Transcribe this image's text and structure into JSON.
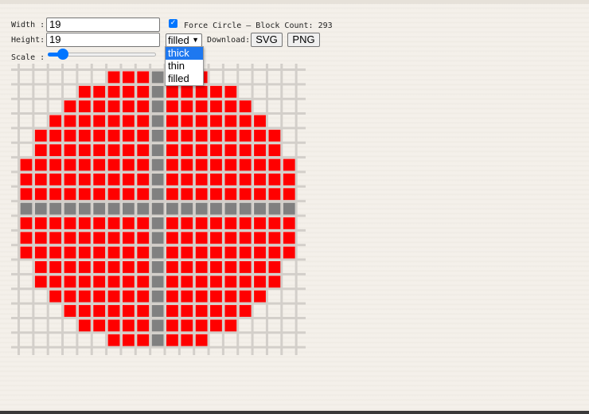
{
  "controls": {
    "width_label": "Width :",
    "width_value": "19",
    "height_label": "Height:",
    "height_value": "19",
    "force_circle_checked": true,
    "force_circle_label": "Force Circle — Block Count: 293",
    "mode_selected": "filled",
    "mode_options": [
      "thick",
      "thin",
      "filled"
    ],
    "mode_highlighted": "thick",
    "download_label": "Download:",
    "svg_button": "SVG",
    "png_button": "PNG",
    "scale_label": "Scale :",
    "scale_fraction": 0.1
  },
  "grid": {
    "columns": 19,
    "rows": 19,
    "fill_color": "#ff0000",
    "axis_color": "#808080",
    "line_color": "#d3cfca",
    "axis_row": 9,
    "axis_col": 9,
    "row_spans": [
      [
        6,
        12
      ],
      [
        4,
        14
      ],
      [
        3,
        15
      ],
      [
        2,
        16
      ],
      [
        1,
        17
      ],
      [
        1,
        17
      ],
      [
        0,
        18
      ],
      [
        0,
        18
      ],
      [
        0,
        18
      ],
      [
        0,
        18
      ],
      [
        0,
        18
      ],
      [
        0,
        18
      ],
      [
        0,
        18
      ],
      [
        1,
        17
      ],
      [
        1,
        17
      ],
      [
        2,
        16
      ],
      [
        3,
        15
      ],
      [
        4,
        14
      ],
      [
        6,
        12
      ]
    ]
  }
}
